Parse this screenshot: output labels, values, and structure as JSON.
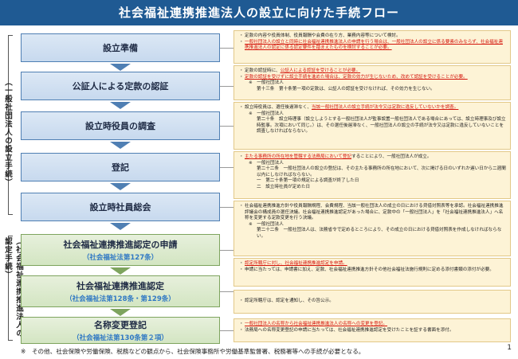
{
  "title": "社会福祉連携推進法人の設立に向けた手続フロー",
  "side_labels": {
    "corp": "（一般社団法人の設立手続）",
    "cert": "（社会福祉連携推進法人の認定手続）"
  },
  "steps": [
    {
      "label": "設立準備",
      "sub": ""
    },
    {
      "label": "公証人による定款の認証",
      "sub": ""
    },
    {
      "label": "設立時役員の調査",
      "sub": ""
    },
    {
      "label": "登記",
      "sub": ""
    },
    {
      "label": "設立時社員総会",
      "sub": ""
    },
    {
      "label": "社会福祉連携推進認定の申請",
      "sub": "（社会福祉法第127条）"
    },
    {
      "label": "社会福祉連携推進認定",
      "sub": "（社会福祉法第128条・第129条）"
    },
    {
      "label": "名称変更登記",
      "sub": "（社会福祉法第130条第２項）"
    }
  ],
  "notes": {
    "n1": {
      "l1": "定款の内容や役員体制、役員報酬や会費の在り方、業務内容等について検討。",
      "l2": "一般社団法人の設立と同時に社会福祉連携推進法人の申請を行う場合は、一般社団法人の設立に係る要素のみならず、社会福祉連携推進法人の認定に係る認定要件を踏まえたものを検討することが必要。"
    },
    "n2": {
      "l1a": "定款の認証時に、",
      "l1b": "公証人による認証を受けることが必要。",
      "l2": "定款の認証を受けずに設立手続を進めた場合は、定款の効力が生じないため、改めて認証を受けることが必要。",
      "l3": "※　一般社団法人",
      "l4": "第十三条　第十条第一項の定款は、公証人の認証を受けなければ、その効力を生じない。"
    },
    "n3": {
      "l1a": "設立時役員は、選任後遅滞なく、",
      "l1b": "当該一般社団法人の設立手続が法令又は定款に違反していないかを調査。",
      "l2": "※　一般社団法人",
      "l3": "第二十条　設立時理事（設立しようとする一般社団法人が監事設置一般社団法人である場合にあっては、設立時理事及び設立時監事。次項において同じ。）は、その選任後遅滞なく、一般社団法人の設立の手続が法令又は定款に違反していないことを調査しなければならない。"
    },
    "n4": {
      "l1a": "主たる事務所の所在地を管轄する法務局において登記",
      "l1b": "することにより、一般社団法人が成立。",
      "l2": "※　一般社団法人",
      "l3": "第二十二条　一般社団法人の設立の登記は、その主たる事務所の所在地において、次に掲げる日のいずれか遅い日から二週間以内にしなければならない。",
      "l4": "一　第二十条第一項の規定による調査が終了した日",
      "l5": "二　設立時社員が定めた日"
    },
    "n5": {
      "l1": "社会福祉連携推進方針や役員報酬規程、会費規程、当該一般社団法人の成立の日における貸借対照表等を承認。社会福祉連携推進評議会の構成員の選任決議。社会福祉連携推進認定があった場合に、定款中の「一般社団法人」を「社会福祉連携推進法人」へ名称を変更する定款変更を行う決議。",
      "l2": "※　一般社団法人",
      "l3": "第二十二条　一般社団法人は、法務省令で定めるところにより、その成立の日における貸借対照表を作成しなければならない。"
    },
    "n6": {
      "l1": "認定所轄庁に対し、社会福祉連携推進認定を申請。",
      "l2": "申請に当たっては、申請書に加え、定款、社会福祉連携推進方針その他社会福祉法施行規則に定める添付書類の添付が必要。"
    },
    "n7": {
      "l1": "認定所轄庁は、認定を通知し、その旨公示。"
    },
    "n8": {
      "l1": "一般社団法人の名称から社会福祉連携推進法人の名称への変更を登記。",
      "l2": "法務局への名称変更登記の申請に当たっては、社会福祉連携推進認定を受けたことを証する書面を添付。"
    }
  },
  "footer": "※　その他、社会保険や労働保険、税務などの観点から、社会保険事務所や労働基準監督署、税務署等への手続が必要となる。",
  "page_number": "1",
  "colors": {
    "title_bar": "#1f5a93",
    "step_blue": "#dce8f5",
    "step_green": "#e7f0dc",
    "note_bg": "#fdf3d6",
    "emphasis_red": "#d4160c"
  }
}
